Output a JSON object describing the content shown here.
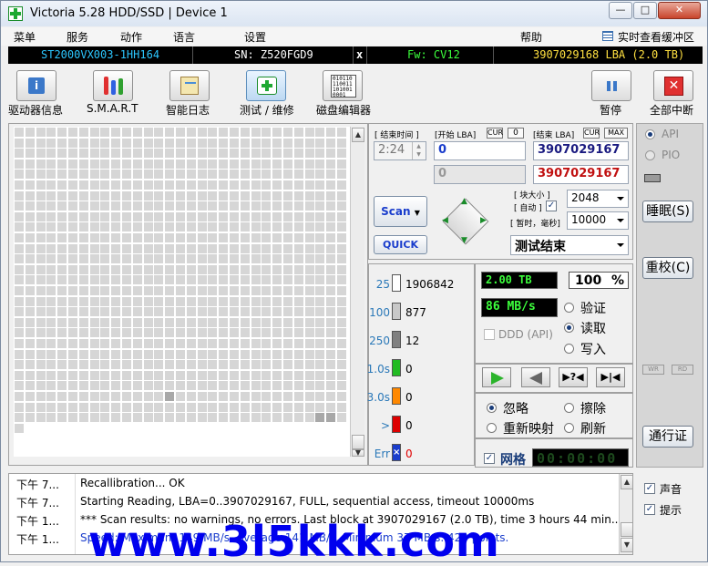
{
  "window": {
    "title": "Victoria 5.28 HDD/SSD | Device 1",
    "controls": [
      "—",
      "□",
      "✕"
    ]
  },
  "menu": {
    "items": [
      "菜单",
      "服务",
      "动作",
      "语言",
      "设置",
      "帮助"
    ],
    "realtime_buffer": "实时查看缓冲区"
  },
  "drive": {
    "model": "ST2000VX003-1HH164",
    "sn": "SN: Z520FGD9",
    "close": "x",
    "fw": "Fw: CV12",
    "lba": "3907029168 LBA (2.0 TB)"
  },
  "toolbar": {
    "drive_info": "驱动器信息",
    "smart": "S.M.A.R.T",
    "smart_log": "智能日志",
    "test_repair": "测试 / 维修",
    "disk_editor": "磁盘编辑器",
    "pause": "暂停",
    "abort_all": "全部中断"
  },
  "scan": {
    "end_time_label": "[ 结束时间 ]",
    "end_time_value": "2:24",
    "start_lba_label": "[开始 LBA]",
    "cur_label": "CUR",
    "start_cur_value": "0",
    "end_lba_label": "[结束 LBA]",
    "max_label": "MAX",
    "start_lba": "0",
    "end_lba": "3907029167",
    "start_lba2": "0",
    "end_lba2": "3907029167",
    "block_size_label": "[ 块大小 ]",
    "auto_label": "[ 自动 ]",
    "timeout_label": "[ 暂时，毫秒]",
    "block_size": "2048",
    "timeout": "10000",
    "scan_button": "Scan",
    "quick_button": "QUICK",
    "status": "测试结束"
  },
  "legend": [
    {
      "label": "25",
      "value": "1906842",
      "color": "#ffffff"
    },
    {
      "label": "100",
      "value": "877",
      "color": "#c8c8c8"
    },
    {
      "label": "250",
      "value": "12",
      "color": "#808080"
    },
    {
      "label": "1.0s",
      "value": "0",
      "color": "#22bb22"
    },
    {
      "label": "3.0s",
      "value": "0",
      "color": "#ff8800"
    },
    {
      "label": ">",
      "value": "0",
      "color": "#dd0000"
    },
    {
      "label": "Err",
      "value": "0",
      "color": "#1a3dcc"
    }
  ],
  "stats": {
    "size": "2.00 TB",
    "percent": "100",
    "percent_sign": "%",
    "speed": "86 MB/s",
    "ddd": "DDD (API)",
    "mode_verify": "验证",
    "mode_read": "读取",
    "mode_write": "写入",
    "action_ignore": "忽略",
    "action_erase": "擦除",
    "action_remap": "重新映射",
    "action_refresh": "刷新",
    "grid_label": "网格",
    "timer": "00:00:00"
  },
  "side": {
    "api": "API",
    "pio": "PIO",
    "sleep": "睡眠(S)",
    "recal": "重校(C)",
    "wr": "WR",
    "rd": "RD",
    "passthrough": "通行证",
    "sound": "声音",
    "hints": "提示"
  },
  "log": [
    {
      "time": "下午 7...",
      "msg": "Recallibration... OK",
      "color": "#000000"
    },
    {
      "time": "下午 7...",
      "msg": "Starting Reading, LBA=0..3907029167, FULL, sequential access, timeout 10000ms",
      "color": "#000000"
    },
    {
      "time": "下午 1...",
      "msg": "*** Scan results: no warnings, no errors. Last block at 3907029167 (2.0 TB), time 3 hours 44 min...",
      "color": "#000000"
    },
    {
      "time": "下午 1...",
      "msg": "Speed: Maximum 149 MB/s. Average 141 MB/s. Minimum 37 MB/s. 423 points.",
      "color": "#1a3dcc"
    }
  ],
  "watermark": "www.3l5kkk.com"
}
